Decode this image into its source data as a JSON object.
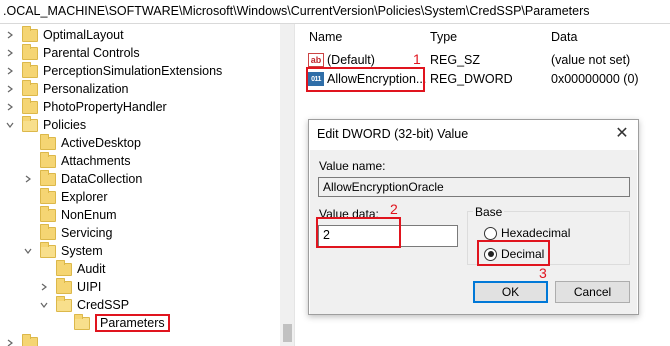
{
  "address_bar": {
    "path": ".OCAL_MACHINE\\SOFTWARE\\Microsoft\\Windows\\CurrentVersion\\Policies\\System\\CredSSP\\Parameters"
  },
  "tree": {
    "items": [
      {
        "label": "OptimalLayout",
        "chevron": "right"
      },
      {
        "label": "Parental Controls",
        "chevron": "right"
      },
      {
        "label": "PerceptionSimulationExtensions",
        "chevron": "right"
      },
      {
        "label": "Personalization",
        "chevron": "right"
      },
      {
        "label": "PhotoPropertyHandler",
        "chevron": "right"
      },
      {
        "label": "Policies",
        "chevron": "down"
      },
      {
        "label": "ActiveDesktop",
        "chevron": "none"
      },
      {
        "label": "Attachments",
        "chevron": "none"
      },
      {
        "label": "DataCollection",
        "chevron": "right"
      },
      {
        "label": "Explorer",
        "chevron": "none"
      },
      {
        "label": "NonEnum",
        "chevron": "none"
      },
      {
        "label": "Servicing",
        "chevron": "none"
      },
      {
        "label": "System",
        "chevron": "down"
      },
      {
        "label": "Audit",
        "chevron": "none"
      },
      {
        "label": "UIPI",
        "chevron": "right"
      },
      {
        "label": "CredSSP",
        "chevron": "down"
      },
      {
        "label": "Parameters",
        "chevron": "none"
      }
    ]
  },
  "list": {
    "headers": {
      "name": "Name",
      "type": "Type",
      "data": "Data"
    },
    "rows": [
      {
        "name": "(Default)",
        "type": "REG_SZ",
        "data": "(value not set)",
        "icon": "string-value-icon"
      },
      {
        "name": "AllowEncryption...",
        "type": "REG_DWORD",
        "data": "0x00000000 (0)",
        "icon": "dword-value-icon"
      }
    ]
  },
  "dialog": {
    "title": "Edit DWORD (32-bit) Value",
    "close_glyph": "✕",
    "value_name_label": "Value name:",
    "value_name": "AllowEncryptionOracle",
    "value_data_label": "Value data:",
    "value_data": "2",
    "base_label": "Base",
    "hex_label": "Hexadecimal",
    "dec_label": "Decimal",
    "selected_base": "Decimal",
    "ok_label": "OK",
    "cancel_label": "Cancel"
  },
  "annotations": {
    "step1": "1",
    "step2": "2",
    "step3": "3",
    "color": "#e0141e"
  }
}
